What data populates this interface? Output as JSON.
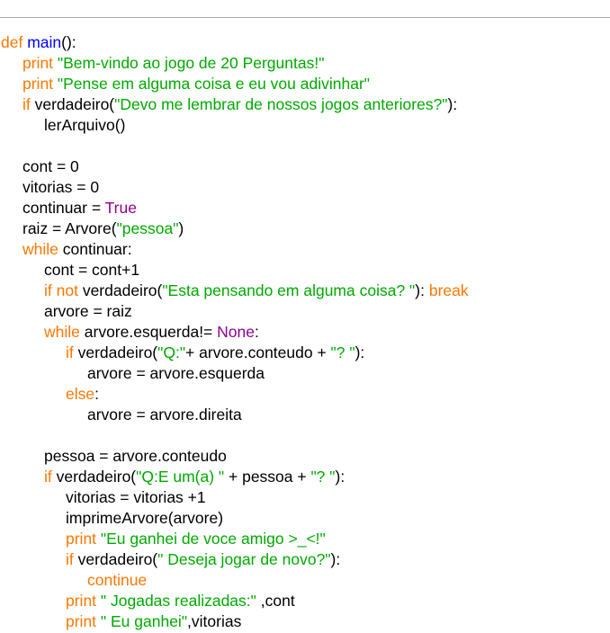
{
  "colors": {
    "keyword": "#ff7700",
    "function_name": "#0000ff",
    "string": "#00aa00",
    "builtin": "#900090",
    "default": "#000000",
    "rule": "#a9a9a9",
    "background": "#ffffff"
  },
  "code": {
    "lines": [
      {
        "indent": 0,
        "tokens": [
          {
            "t": "def",
            "k": "kw"
          },
          {
            "t": " "
          },
          {
            "t": "main",
            "k": "fn"
          },
          {
            "t": "():"
          }
        ]
      },
      {
        "indent": 1,
        "tokens": [
          {
            "t": "print",
            "k": "kw"
          },
          {
            "t": " "
          },
          {
            "t": "\"Bem-vindo ao jogo de 20 Perguntas!\"",
            "k": "str"
          }
        ]
      },
      {
        "indent": 1,
        "tokens": [
          {
            "t": "print",
            "k": "kw"
          },
          {
            "t": " "
          },
          {
            "t": "\"Pense em alguma coisa e eu vou adivinhar\"",
            "k": "str"
          }
        ]
      },
      {
        "indent": 1,
        "tokens": [
          {
            "t": "if",
            "k": "kw"
          },
          {
            "t": " verdadeiro("
          },
          {
            "t": "\"Devo me lembrar de nossos jogos anteriores?\"",
            "k": "str"
          },
          {
            "t": "):"
          }
        ]
      },
      {
        "indent": 2,
        "tokens": [
          {
            "t": "lerArquivo()"
          }
        ]
      },
      {
        "indent": 0,
        "tokens": []
      },
      {
        "indent": 1,
        "tokens": [
          {
            "t": "cont = 0"
          }
        ]
      },
      {
        "indent": 1,
        "tokens": [
          {
            "t": "vitorias = 0"
          }
        ]
      },
      {
        "indent": 1,
        "tokens": [
          {
            "t": "continuar = "
          },
          {
            "t": "True",
            "k": "bi"
          }
        ]
      },
      {
        "indent": 1,
        "tokens": [
          {
            "t": "raiz = Arvore("
          },
          {
            "t": "\"pessoa\"",
            "k": "str"
          },
          {
            "t": ")"
          }
        ]
      },
      {
        "indent": 1,
        "tokens": [
          {
            "t": "while",
            "k": "kw"
          },
          {
            "t": " continuar:"
          }
        ]
      },
      {
        "indent": 2,
        "tokens": [
          {
            "t": "cont = cont+1"
          }
        ]
      },
      {
        "indent": 2,
        "tokens": [
          {
            "t": "if not",
            "k": "kw"
          },
          {
            "t": " verdadeiro("
          },
          {
            "t": "\"Esta pensando em alguma coisa? \"",
            "k": "str"
          },
          {
            "t": "): "
          },
          {
            "t": "break",
            "k": "kw"
          }
        ]
      },
      {
        "indent": 2,
        "tokens": [
          {
            "t": "arvore = raiz"
          }
        ]
      },
      {
        "indent": 2,
        "tokens": [
          {
            "t": "while",
            "k": "kw"
          },
          {
            "t": " arvore.esquerda!= "
          },
          {
            "t": "None",
            "k": "bi"
          },
          {
            "t": ":"
          }
        ]
      },
      {
        "indent": 3,
        "tokens": [
          {
            "t": "if",
            "k": "kw"
          },
          {
            "t": " verdadeiro("
          },
          {
            "t": "\"Q:\"",
            "k": "str"
          },
          {
            "t": "+ arvore.conteudo + "
          },
          {
            "t": "\"? \"",
            "k": "str"
          },
          {
            "t": "):"
          }
        ]
      },
      {
        "indent": 4,
        "tokens": [
          {
            "t": "arvore = arvore.esquerda"
          }
        ]
      },
      {
        "indent": 3,
        "tokens": [
          {
            "t": "else",
            "k": "kw"
          },
          {
            "t": ":"
          }
        ]
      },
      {
        "indent": 4,
        "tokens": [
          {
            "t": "arvore = arvore.direita"
          }
        ]
      },
      {
        "indent": 0,
        "tokens": []
      },
      {
        "indent": 2,
        "tokens": [
          {
            "t": "pessoa = arvore.conteudo"
          }
        ]
      },
      {
        "indent": 2,
        "tokens": [
          {
            "t": "if",
            "k": "kw"
          },
          {
            "t": " verdadeiro("
          },
          {
            "t": "\"Q:E um(a) \"",
            "k": "str"
          },
          {
            "t": " + pessoa + "
          },
          {
            "t": "\"? \"",
            "k": "str"
          },
          {
            "t": "):"
          }
        ]
      },
      {
        "indent": 3,
        "tokens": [
          {
            "t": "vitorias = vitorias +1"
          }
        ]
      },
      {
        "indent": 3,
        "tokens": [
          {
            "t": "imprimeArvore(arvore)"
          }
        ]
      },
      {
        "indent": 3,
        "tokens": [
          {
            "t": "print",
            "k": "kw"
          },
          {
            "t": " "
          },
          {
            "t": "\"Eu ganhei de voce amigo >_<!\"",
            "k": "str"
          }
        ]
      },
      {
        "indent": 3,
        "tokens": [
          {
            "t": "if",
            "k": "kw"
          },
          {
            "t": " verdadeiro("
          },
          {
            "t": "\" Deseja jogar de novo?\"",
            "k": "str"
          },
          {
            "t": "):"
          }
        ]
      },
      {
        "indent": 4,
        "tokens": [
          {
            "t": "continue",
            "k": "kw"
          }
        ]
      },
      {
        "indent": 3,
        "tokens": [
          {
            "t": "print",
            "k": "kw"
          },
          {
            "t": " "
          },
          {
            "t": "\" Jogadas realizadas:\"",
            "k": "str"
          },
          {
            "t": " ,cont"
          }
        ]
      },
      {
        "indent": 3,
        "tokens": [
          {
            "t": "print",
            "k": "kw"
          },
          {
            "t": " "
          },
          {
            "t": "\" Eu ganhei\"",
            "k": "str"
          },
          {
            "t": ",vitorias"
          }
        ]
      }
    ]
  }
}
